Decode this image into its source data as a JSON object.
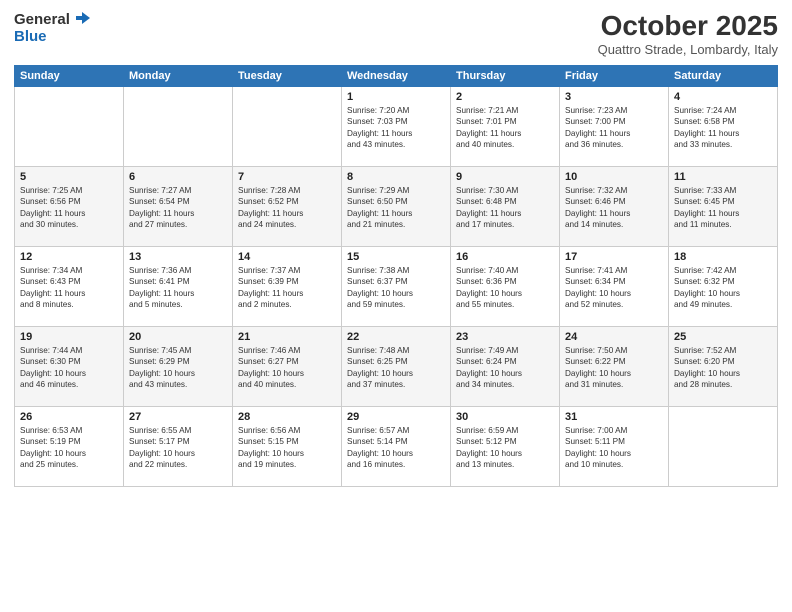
{
  "logo": {
    "general": "General",
    "blue": "Blue"
  },
  "header": {
    "title": "October 2025",
    "location": "Quattro Strade, Lombardy, Italy"
  },
  "weekdays": [
    "Sunday",
    "Monday",
    "Tuesday",
    "Wednesday",
    "Thursday",
    "Friday",
    "Saturday"
  ],
  "weeks": [
    [
      {
        "day": "",
        "info": ""
      },
      {
        "day": "",
        "info": ""
      },
      {
        "day": "",
        "info": ""
      },
      {
        "day": "1",
        "info": "Sunrise: 7:20 AM\nSunset: 7:03 PM\nDaylight: 11 hours\nand 43 minutes."
      },
      {
        "day": "2",
        "info": "Sunrise: 7:21 AM\nSunset: 7:01 PM\nDaylight: 11 hours\nand 40 minutes."
      },
      {
        "day": "3",
        "info": "Sunrise: 7:23 AM\nSunset: 7:00 PM\nDaylight: 11 hours\nand 36 minutes."
      },
      {
        "day": "4",
        "info": "Sunrise: 7:24 AM\nSunset: 6:58 PM\nDaylight: 11 hours\nand 33 minutes."
      }
    ],
    [
      {
        "day": "5",
        "info": "Sunrise: 7:25 AM\nSunset: 6:56 PM\nDaylight: 11 hours\nand 30 minutes."
      },
      {
        "day": "6",
        "info": "Sunrise: 7:27 AM\nSunset: 6:54 PM\nDaylight: 11 hours\nand 27 minutes."
      },
      {
        "day": "7",
        "info": "Sunrise: 7:28 AM\nSunset: 6:52 PM\nDaylight: 11 hours\nand 24 minutes."
      },
      {
        "day": "8",
        "info": "Sunrise: 7:29 AM\nSunset: 6:50 PM\nDaylight: 11 hours\nand 21 minutes."
      },
      {
        "day": "9",
        "info": "Sunrise: 7:30 AM\nSunset: 6:48 PM\nDaylight: 11 hours\nand 17 minutes."
      },
      {
        "day": "10",
        "info": "Sunrise: 7:32 AM\nSunset: 6:46 PM\nDaylight: 11 hours\nand 14 minutes."
      },
      {
        "day": "11",
        "info": "Sunrise: 7:33 AM\nSunset: 6:45 PM\nDaylight: 11 hours\nand 11 minutes."
      }
    ],
    [
      {
        "day": "12",
        "info": "Sunrise: 7:34 AM\nSunset: 6:43 PM\nDaylight: 11 hours\nand 8 minutes."
      },
      {
        "day": "13",
        "info": "Sunrise: 7:36 AM\nSunset: 6:41 PM\nDaylight: 11 hours\nand 5 minutes."
      },
      {
        "day": "14",
        "info": "Sunrise: 7:37 AM\nSunset: 6:39 PM\nDaylight: 11 hours\nand 2 minutes."
      },
      {
        "day": "15",
        "info": "Sunrise: 7:38 AM\nSunset: 6:37 PM\nDaylight: 10 hours\nand 59 minutes."
      },
      {
        "day": "16",
        "info": "Sunrise: 7:40 AM\nSunset: 6:36 PM\nDaylight: 10 hours\nand 55 minutes."
      },
      {
        "day": "17",
        "info": "Sunrise: 7:41 AM\nSunset: 6:34 PM\nDaylight: 10 hours\nand 52 minutes."
      },
      {
        "day": "18",
        "info": "Sunrise: 7:42 AM\nSunset: 6:32 PM\nDaylight: 10 hours\nand 49 minutes."
      }
    ],
    [
      {
        "day": "19",
        "info": "Sunrise: 7:44 AM\nSunset: 6:30 PM\nDaylight: 10 hours\nand 46 minutes."
      },
      {
        "day": "20",
        "info": "Sunrise: 7:45 AM\nSunset: 6:29 PM\nDaylight: 10 hours\nand 43 minutes."
      },
      {
        "day": "21",
        "info": "Sunrise: 7:46 AM\nSunset: 6:27 PM\nDaylight: 10 hours\nand 40 minutes."
      },
      {
        "day": "22",
        "info": "Sunrise: 7:48 AM\nSunset: 6:25 PM\nDaylight: 10 hours\nand 37 minutes."
      },
      {
        "day": "23",
        "info": "Sunrise: 7:49 AM\nSunset: 6:24 PM\nDaylight: 10 hours\nand 34 minutes."
      },
      {
        "day": "24",
        "info": "Sunrise: 7:50 AM\nSunset: 6:22 PM\nDaylight: 10 hours\nand 31 minutes."
      },
      {
        "day": "25",
        "info": "Sunrise: 7:52 AM\nSunset: 6:20 PM\nDaylight: 10 hours\nand 28 minutes."
      }
    ],
    [
      {
        "day": "26",
        "info": "Sunrise: 6:53 AM\nSunset: 5:19 PM\nDaylight: 10 hours\nand 25 minutes."
      },
      {
        "day": "27",
        "info": "Sunrise: 6:55 AM\nSunset: 5:17 PM\nDaylight: 10 hours\nand 22 minutes."
      },
      {
        "day": "28",
        "info": "Sunrise: 6:56 AM\nSunset: 5:15 PM\nDaylight: 10 hours\nand 19 minutes."
      },
      {
        "day": "29",
        "info": "Sunrise: 6:57 AM\nSunset: 5:14 PM\nDaylight: 10 hours\nand 16 minutes."
      },
      {
        "day": "30",
        "info": "Sunrise: 6:59 AM\nSunset: 5:12 PM\nDaylight: 10 hours\nand 13 minutes."
      },
      {
        "day": "31",
        "info": "Sunrise: 7:00 AM\nSunset: 5:11 PM\nDaylight: 10 hours\nand 10 minutes."
      },
      {
        "day": "",
        "info": ""
      }
    ]
  ]
}
